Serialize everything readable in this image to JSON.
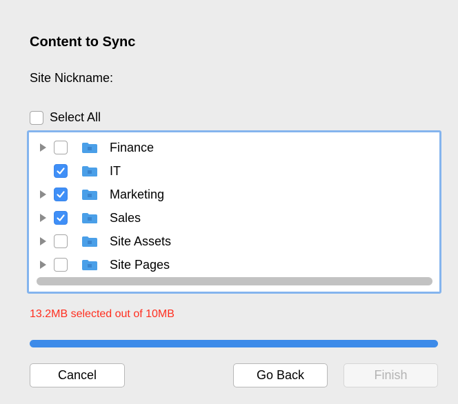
{
  "dialog": {
    "title": "Content to Sync",
    "nickname_label": "Site Nickname:",
    "select_all_label": "Select All",
    "select_all_checked": false,
    "folders": [
      {
        "label": "Finance",
        "checked": false,
        "expandable": true
      },
      {
        "label": "IT",
        "checked": true,
        "expandable": false
      },
      {
        "label": "Marketing",
        "checked": true,
        "expandable": true
      },
      {
        "label": "Sales",
        "checked": true,
        "expandable": true
      },
      {
        "label": "Site Assets",
        "checked": false,
        "expandable": true
      },
      {
        "label": "Site Pages",
        "checked": false,
        "expandable": true
      }
    ],
    "status_text": "13.2MB selected out of 10MB",
    "progress_fraction": 1.0,
    "buttons": {
      "cancel": "Cancel",
      "go_back": "Go Back",
      "finish": "Finish"
    }
  },
  "colors": {
    "accent": "#3f8ff7",
    "error": "#ff2e1f",
    "folder": "#4a9fe8"
  },
  "icons": {
    "disclosure": "disclosure-triangle-icon",
    "folder": "folder-icon",
    "checkmark": "checkmark-icon"
  }
}
